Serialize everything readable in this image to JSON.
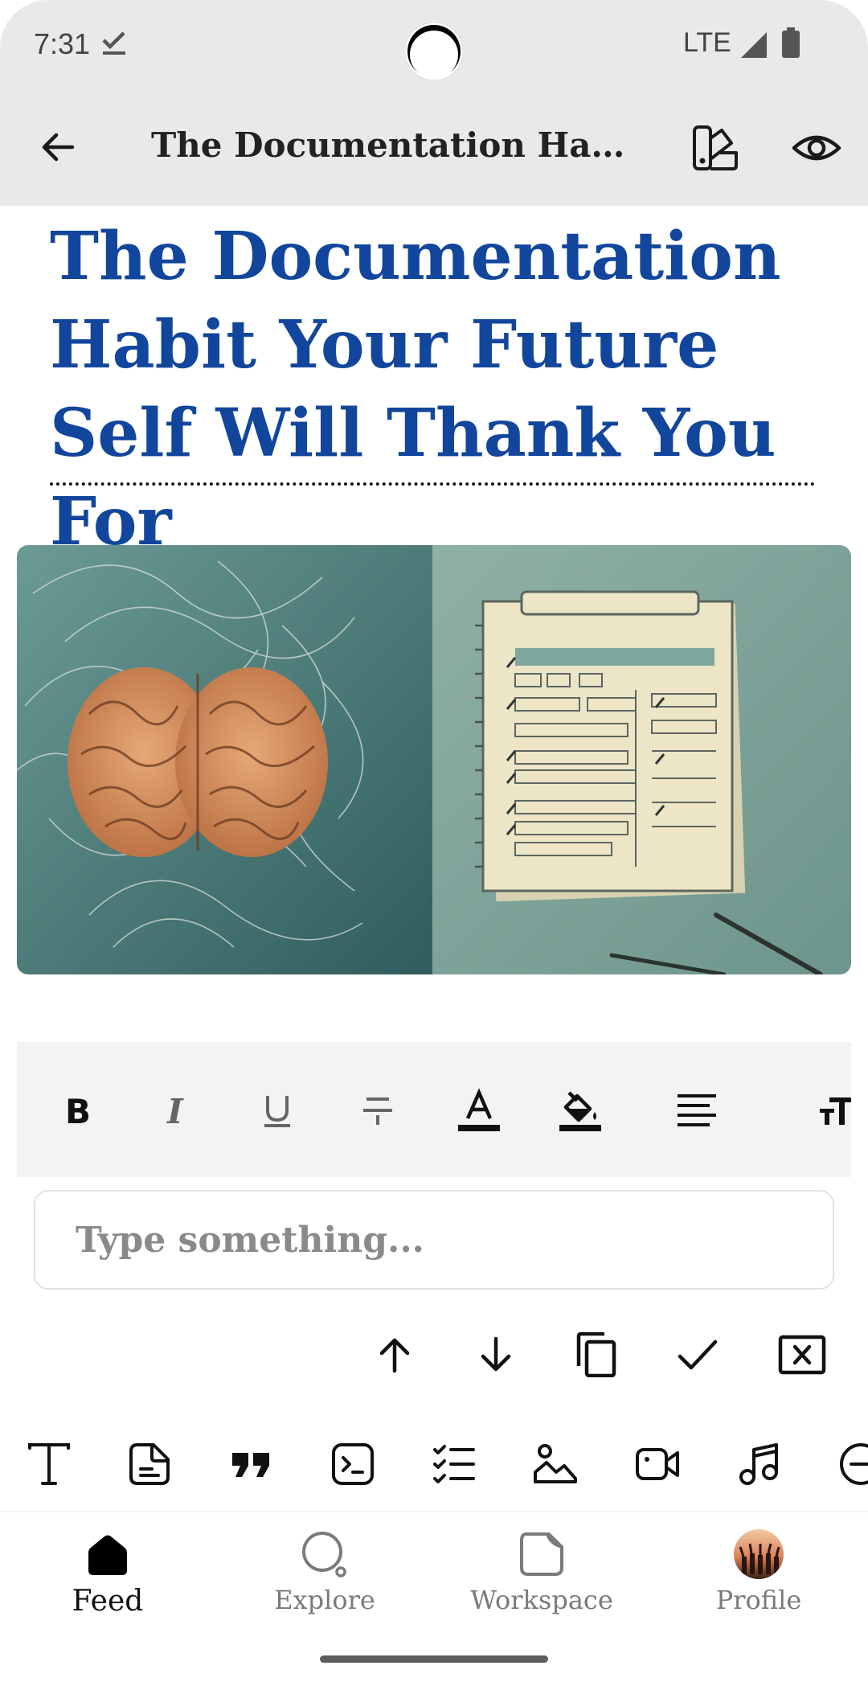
{
  "status_bar": {
    "time": "7:31",
    "network": "LTE"
  },
  "app_bar": {
    "title": "The Documentation Habi..."
  },
  "article": {
    "title": "The Documentation Habit Your Future Self Will Thank You For"
  },
  "input": {
    "placeholder": "Type something..."
  },
  "formatting_toolbar": {
    "tools": [
      "bold-icon",
      "italic-icon",
      "underline-icon",
      "strikethrough-icon",
      "text-color-icon",
      "highlight-color-icon",
      "align-left-icon",
      "text-size-icon"
    ]
  },
  "block_actions": [
    "move-up-icon",
    "move-down-icon",
    "duplicate-icon",
    "confirm-icon",
    "delete-block-icon"
  ],
  "insert_toolbar": [
    "text-block-icon",
    "note-block-icon",
    "quote-block-icon",
    "code-block-icon",
    "checklist-block-icon",
    "image-block-icon",
    "video-block-icon",
    "audio-block-icon",
    "divider-block-icon"
  ],
  "bottom_nav": {
    "items": [
      {
        "label": "Feed",
        "active": true
      },
      {
        "label": "Explore",
        "active": false
      },
      {
        "label": "Workspace",
        "active": false
      },
      {
        "label": "Profile",
        "active": false
      }
    ]
  },
  "colors": {
    "title_blue": "#12469c",
    "bar_gray": "#e9e9e9",
    "toolbar_gray": "#f3f3f3"
  }
}
